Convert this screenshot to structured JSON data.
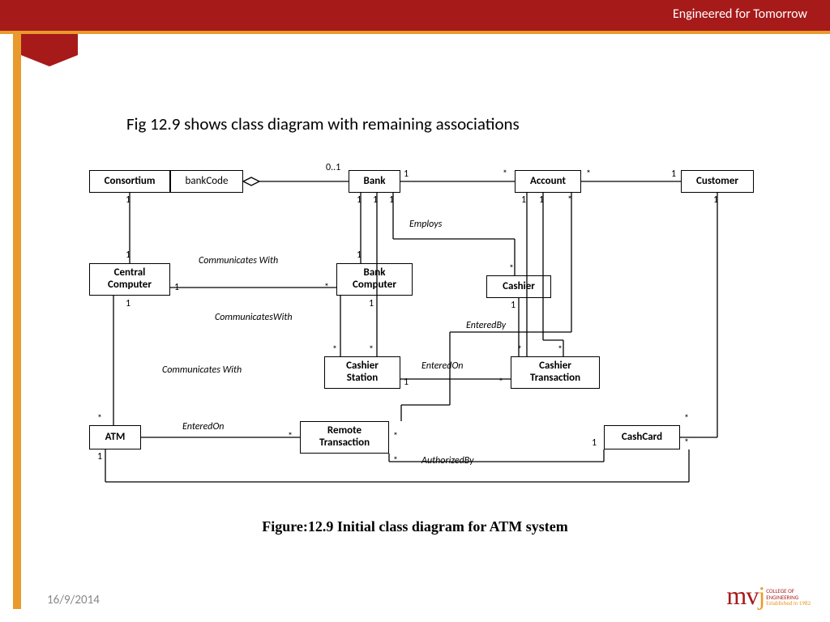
{
  "header": {
    "tagline": "Engineered for Tomorrow"
  },
  "title": "Fig 12.9 shows class diagram with remaining associations",
  "caption": "Figure:12.9 Initial class diagram for ATM system",
  "footer": {
    "date": "16/9/2014"
  },
  "logo": {
    "brand_m": "m",
    "brand_v": "v",
    "brand_j": "j",
    "sub1": "COLLEGE OF",
    "sub2": "ENGINEERING",
    "sub3": "Established in 1982"
  },
  "classes": {
    "consortium": "Consortium",
    "bankcode": "bankCode",
    "bank": "Bank",
    "account": "Account",
    "customer": "Customer",
    "central_computer": "Central\nComputer",
    "bank_computer": "Bank\nComputer",
    "cashier": "Cashier",
    "cashier_station": "Cashier\nStation",
    "cashier_transaction": "Cashier\nTransaction",
    "atm": "ATM",
    "remote_transaction": "Remote\nTransaction",
    "cashcard": "CashCard"
  },
  "associations": {
    "communicates_with": "Communicates\nWith",
    "communicates_with2": "CommunicatesWith",
    "communicates_with3": "Communicates\nWith",
    "employs": "Employs",
    "entered_by": "EnteredBy",
    "entered_on": "EnteredOn",
    "entered_on2": "EnteredOn",
    "authorized_by": "AuthorizedBy"
  },
  "mult": {
    "zero_one": "0..1",
    "one": "1",
    "many": "*"
  }
}
